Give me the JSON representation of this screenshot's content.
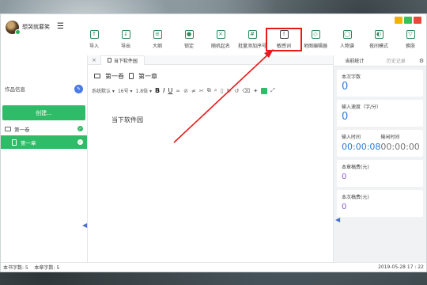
{
  "user": {
    "name": "想哭就要笑"
  },
  "toolbar": [
    {
      "label": "导入",
      "icon": "upload-icon",
      "glyph": "↑"
    },
    {
      "label": "导出",
      "icon": "download-icon",
      "glyph": "↓"
    },
    {
      "label": "大纲",
      "icon": "outline-icon",
      "glyph": "≡"
    },
    {
      "label": "锁定",
      "icon": "lock-icon",
      "glyph": "●"
    },
    {
      "label": "随机起名",
      "icon": "random-name-icon",
      "glyph": "×"
    },
    {
      "label": "批量添加序号",
      "icon": "numbering-icon",
      "glyph": "#"
    },
    {
      "label": "敏感词",
      "icon": "warning-icon",
      "glyph": "!"
    },
    {
      "label": "地图编辑器",
      "icon": "map-icon",
      "glyph": "◇"
    },
    {
      "label": "人物谱",
      "icon": "person-icon",
      "glyph": "◯"
    },
    {
      "label": "夜间模式",
      "icon": "moon-icon",
      "glyph": "◐"
    },
    {
      "label": "换肤",
      "icon": "shirt-icon",
      "glyph": "▽"
    }
  ],
  "sidebar": {
    "work_info": "作品信息",
    "create_label": "创建...",
    "volume": "第一卷",
    "chapter": "第一章"
  },
  "tabs": [
    {
      "label": "当下软件园"
    }
  ],
  "breadcrumb": {
    "volume": "第一卷",
    "chapter": "第一章"
  },
  "format": {
    "font": "系统默认",
    "size": "16号",
    "line_height": "1.8倍"
  },
  "editor": {
    "text": "当下软件园"
  },
  "right": {
    "tab_active": "当前统计",
    "tab_inactive": "历史记录",
    "current_words_label": "本次字数",
    "current_words": "0",
    "speed_label": "输入速度（字/分）",
    "speed": "0",
    "input_time_label": "输入时间",
    "input_time": "00:00:08",
    "pause_time_label": "输闲时间",
    "pause_time": "00:00:00",
    "chapter_fee_label": "本章稿费(元)",
    "chapter_fee": "0",
    "session_fee_label": "本次稿费(元)",
    "session_fee": "0"
  },
  "status": {
    "book_words": "本书字数: 5",
    "chapter_words": "本章字数: 5",
    "datetime": "2019-05-28 17 : 22"
  },
  "colors": {
    "accent": "#2fbc68",
    "highlight": "#e8191b",
    "blue": "#2a7ad6"
  }
}
